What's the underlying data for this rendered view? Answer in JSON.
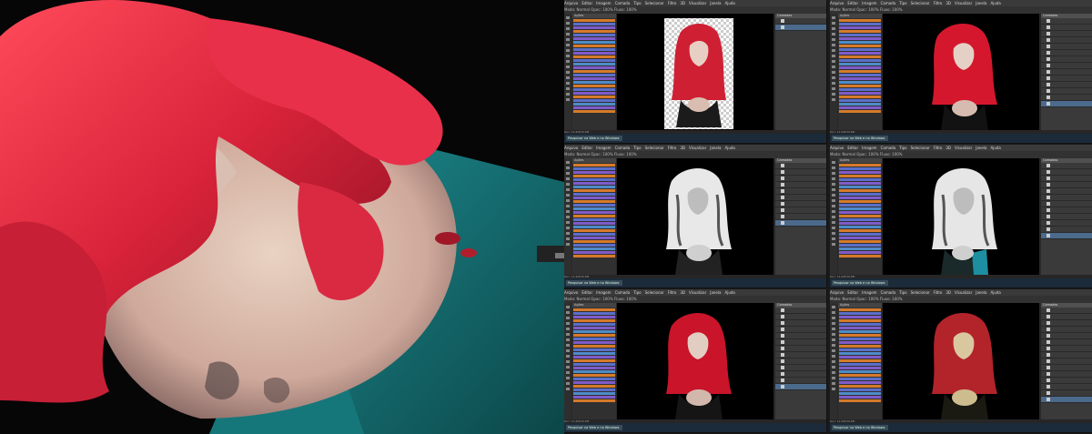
{
  "menu": [
    "Arquivo",
    "Editar",
    "Imagem",
    "Camada",
    "Tipo",
    "Selecionar",
    "Filtro",
    "3D",
    "Visualizar",
    "Janela",
    "Ajuda"
  ],
  "options": "Modo: Normal   Opac: 100%   Fluxo: 100%",
  "actions_header": "Ações",
  "layers_header": "Camadas",
  "taskbar_search": "Pesquisar na Web e no Windows",
  "status": "Doc: 12,4M/39,8M",
  "action_colors": [
    "#d67a2a",
    "#5b6fc9",
    "#7f5bc9",
    "#d67a2a",
    "#5b6fc9",
    "#7f5bc9",
    "#4f8bc9",
    "#d67a2a",
    "#5b6fc9",
    "#7f5bc9",
    "#d67a2a",
    "#5b6fc9",
    "#4f8bc9",
    "#7f5bc9",
    "#d67a2a",
    "#5b6fc9",
    "#7f5bc9",
    "#4f8bc9",
    "#d67a2a",
    "#5b6fc9",
    "#7f5bc9",
    "#d67a2a",
    "#5b6fc9",
    "#4f8bc9",
    "#7f5bc9",
    "#d67a2a"
  ],
  "panels": [
    {
      "variant": "transparent",
      "layer_count": 2
    },
    {
      "variant": "color",
      "layer_count": 14
    },
    {
      "variant": "bw",
      "layer_count": 10
    },
    {
      "variant": "bw-teal",
      "layer_count": 12
    },
    {
      "variant": "color",
      "layer_count": 13
    },
    {
      "variant": "warm",
      "layer_count": 15
    }
  ]
}
